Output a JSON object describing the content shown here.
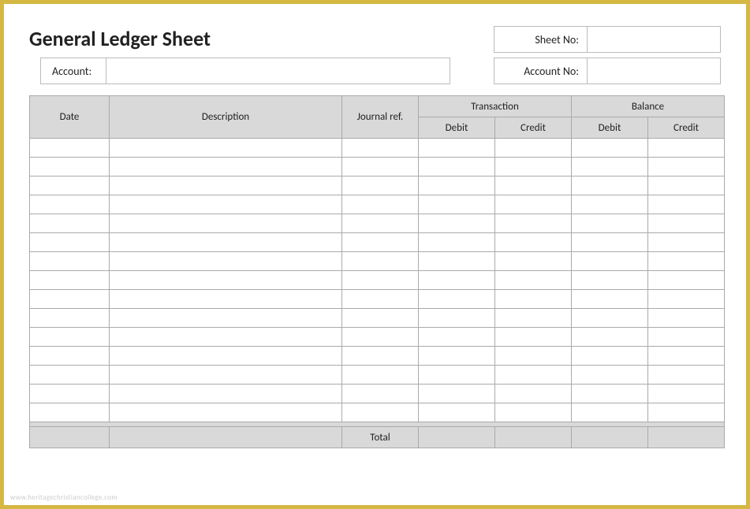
{
  "title": "General Ledger Sheet",
  "fields": {
    "sheet_no_label": "Sheet No:",
    "sheet_no_value": "",
    "account_label": "Account:",
    "account_value": "",
    "account_no_label": "Account No:",
    "account_no_value": ""
  },
  "columns": {
    "date": "Date",
    "description": "Description",
    "journal_ref": "Journal ref.",
    "transaction": "Transaction",
    "balance": "Balance",
    "debit": "Debit",
    "credit": "Credit"
  },
  "rows": [
    {
      "date": "",
      "description": "",
      "journal_ref": "",
      "t_debit": "",
      "t_credit": "",
      "b_debit": "",
      "b_credit": ""
    },
    {
      "date": "",
      "description": "",
      "journal_ref": "",
      "t_debit": "",
      "t_credit": "",
      "b_debit": "",
      "b_credit": ""
    },
    {
      "date": "",
      "description": "",
      "journal_ref": "",
      "t_debit": "",
      "t_credit": "",
      "b_debit": "",
      "b_credit": ""
    },
    {
      "date": "",
      "description": "",
      "journal_ref": "",
      "t_debit": "",
      "t_credit": "",
      "b_debit": "",
      "b_credit": ""
    },
    {
      "date": "",
      "description": "",
      "journal_ref": "",
      "t_debit": "",
      "t_credit": "",
      "b_debit": "",
      "b_credit": ""
    },
    {
      "date": "",
      "description": "",
      "journal_ref": "",
      "t_debit": "",
      "t_credit": "",
      "b_debit": "",
      "b_credit": ""
    },
    {
      "date": "",
      "description": "",
      "journal_ref": "",
      "t_debit": "",
      "t_credit": "",
      "b_debit": "",
      "b_credit": ""
    },
    {
      "date": "",
      "description": "",
      "journal_ref": "",
      "t_debit": "",
      "t_credit": "",
      "b_debit": "",
      "b_credit": ""
    },
    {
      "date": "",
      "description": "",
      "journal_ref": "",
      "t_debit": "",
      "t_credit": "",
      "b_debit": "",
      "b_credit": ""
    },
    {
      "date": "",
      "description": "",
      "journal_ref": "",
      "t_debit": "",
      "t_credit": "",
      "b_debit": "",
      "b_credit": ""
    },
    {
      "date": "",
      "description": "",
      "journal_ref": "",
      "t_debit": "",
      "t_credit": "",
      "b_debit": "",
      "b_credit": ""
    },
    {
      "date": "",
      "description": "",
      "journal_ref": "",
      "t_debit": "",
      "t_credit": "",
      "b_debit": "",
      "b_credit": ""
    },
    {
      "date": "",
      "description": "",
      "journal_ref": "",
      "t_debit": "",
      "t_credit": "",
      "b_debit": "",
      "b_credit": ""
    },
    {
      "date": "",
      "description": "",
      "journal_ref": "",
      "t_debit": "",
      "t_credit": "",
      "b_debit": "",
      "b_credit": ""
    },
    {
      "date": "",
      "description": "",
      "journal_ref": "",
      "t_debit": "",
      "t_credit": "",
      "b_debit": "",
      "b_credit": ""
    }
  ],
  "total_label": "Total",
  "totals": {
    "t_debit": "",
    "t_credit": "",
    "b_debit": "",
    "b_credit": ""
  },
  "watermark": "www.heritagechristiancollege.com"
}
